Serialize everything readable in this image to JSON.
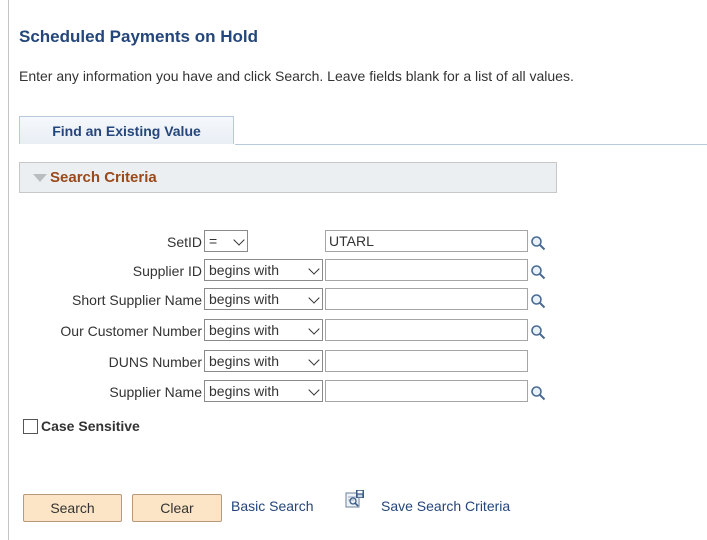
{
  "page": {
    "title": "Scheduled Payments on Hold",
    "instructions": "Enter any information you have and click Search. Leave fields blank for a list of all values."
  },
  "tabs": [
    {
      "label": "Find an Existing Value"
    }
  ],
  "search_criteria": {
    "title": "Search Criteria",
    "fields": [
      {
        "label": "SetID",
        "operator": "=",
        "value": "UTARL",
        "lookup": true
      },
      {
        "label": "Supplier ID",
        "operator": "begins with",
        "value": "",
        "lookup": true
      },
      {
        "label": "Short Supplier Name",
        "operator": "begins with",
        "value": "",
        "lookup": true
      },
      {
        "label": "Our Customer Number",
        "operator": "begins with",
        "value": "",
        "lookup": true
      },
      {
        "label": "DUNS Number",
        "operator": "begins with",
        "value": "",
        "lookup": false
      },
      {
        "label": "Supplier Name",
        "operator": "begins with",
        "value": "",
        "lookup": true
      }
    ],
    "case_sensitive": {
      "label": "Case Sensitive",
      "checked": false
    }
  },
  "actions": {
    "search": "Search",
    "clear": "Clear",
    "basic_search": "Basic Search",
    "save_search_criteria": "Save Search Criteria"
  },
  "icons": {
    "lookup": "magnifier-lookup-icon",
    "save": "save-search-icon",
    "collapse": "collapse-triangle-icon"
  },
  "colors": {
    "title": "#24467a",
    "section_title": "#9a4a1a",
    "button_bg": "#fce5c7",
    "link": "#24467a"
  }
}
